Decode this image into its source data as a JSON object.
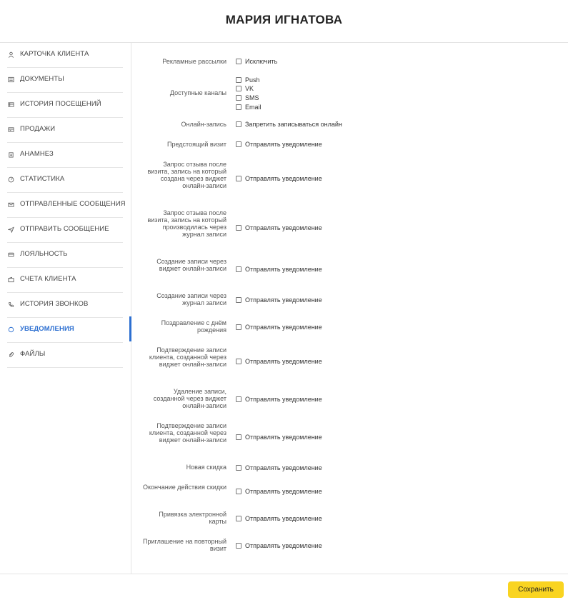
{
  "header": {
    "title": "МАРИЯ ИГНАТОВА"
  },
  "sidebar": {
    "items": [
      {
        "label": "КАРТОЧКА КЛИЕНТА",
        "icon": "user-icon"
      },
      {
        "label": "ДОКУМЕНТЫ",
        "icon": "document-icon"
      },
      {
        "label": "ИСТОРИЯ ПОСЕЩЕНИЙ",
        "icon": "list-icon"
      },
      {
        "label": "ПРОДАЖИ",
        "icon": "sales-icon"
      },
      {
        "label": "АНАМНЕЗ",
        "icon": "anamnesis-icon"
      },
      {
        "label": "СТАТИСТИКА",
        "icon": "gauge-icon"
      },
      {
        "label": "ОТПРАВЛЕННЫЕ СООБЩЕНИЯ",
        "icon": "envelope-icon"
      },
      {
        "label": "ОТПРАВИТЬ СООБЩЕНИЕ",
        "icon": "send-icon"
      },
      {
        "label": "ЛОЯЛЬНОСТЬ",
        "icon": "card-icon"
      },
      {
        "label": "СЧЕТА КЛИЕНТА",
        "icon": "wallet-icon"
      },
      {
        "label": "ИСТОРИЯ ЗВОНКОВ",
        "icon": "phone-icon"
      },
      {
        "label": "УВЕДОМЛЕНИЯ",
        "icon": "chat-icon",
        "active": true
      },
      {
        "label": "ФАЙЛЫ",
        "icon": "paperclip-icon"
      }
    ]
  },
  "settings": {
    "ads": {
      "label": "Рекламные рассылки",
      "option": "Исключить"
    },
    "channels": {
      "label": "Доступные каналы",
      "options": [
        "Push",
        "VK",
        "SMS",
        "Email"
      ]
    },
    "online": {
      "label": "Онлайн-запись",
      "option": "Запретить записываться онлайн"
    },
    "rows": [
      {
        "label": "Предстоящий визит",
        "option": "Отправлять уведомление"
      },
      {
        "label": "Запрос отзыва после визита, запись на который создана через виджет онлайн-записи",
        "option": "Отправлять уведомление"
      },
      {
        "label": "Запрос отзыва после визита, запись на который производилась через журнал записи",
        "option": "Отправлять уведомление"
      },
      {
        "label": "Создание записи через виджет онлайн-записи",
        "option": "Отправлять уведомление"
      },
      {
        "label": "Создание записи через журнал записи",
        "option": "Отправлять уведомление"
      },
      {
        "label": "Поздравление с днём рождения",
        "option": "Отправлять уведомление"
      },
      {
        "label": "Подтверждение записи клиента, созданной через виджет онлайн-записи",
        "option": "Отправлять уведомление"
      },
      {
        "label": "Удаление записи, созданной через виджет онлайн-записи",
        "option": "Отправлять уведомление"
      },
      {
        "label": "Подтверждение записи клиента, созданной через виджет онлайн-записи",
        "option": "Отправлять уведомление"
      },
      {
        "label": "Новая скидка",
        "option": "Отправлять уведомление"
      },
      {
        "label": "Окончание действия скидки",
        "option": "Отправлять уведомление"
      },
      {
        "label": "Привязка электронной карты",
        "option": "Отправлять уведомление"
      },
      {
        "label": "Приглашение на повторный визит",
        "option": "Отправлять уведомление"
      }
    ]
  },
  "footer": {
    "save_label": "Сохранить",
    "save_color": "#f9d421"
  },
  "colors": {
    "accent": "#2c6fd1"
  }
}
